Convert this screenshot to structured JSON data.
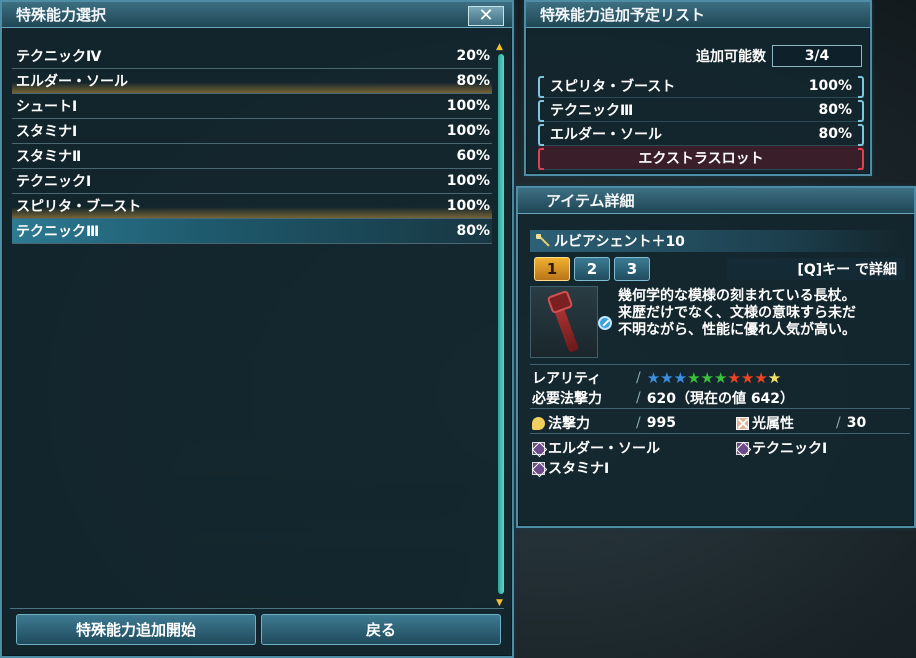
{
  "select_panel": {
    "title": "特殊能力選択",
    "close_glyph": "✕",
    "abilities": [
      {
        "name": "テクニックⅣ",
        "rate": "20%",
        "state": "normal"
      },
      {
        "name": "エルダー・ソール",
        "rate": "80%",
        "state": "selected"
      },
      {
        "name": "シュートⅠ",
        "rate": "100%",
        "state": "normal"
      },
      {
        "name": "スタミナⅠ",
        "rate": "100%",
        "state": "normal"
      },
      {
        "name": "スタミナⅡ",
        "rate": "60%",
        "state": "normal"
      },
      {
        "name": "テクニックⅠ",
        "rate": "100%",
        "state": "normal"
      },
      {
        "name": "スピリタ・ブースト",
        "rate": "100%",
        "state": "selected"
      },
      {
        "name": "テクニックⅢ",
        "rate": "80%",
        "state": "cursor"
      }
    ],
    "start_button": "特殊能力追加開始",
    "back_button": "戻る"
  },
  "queue_panel": {
    "title": "特殊能力追加予定リスト",
    "available_label": "追加可能数",
    "available_value": "3/4",
    "items": [
      {
        "name": "スピリタ・ブースト",
        "rate": "100%"
      },
      {
        "name": "テクニックⅢ",
        "rate": "80%"
      },
      {
        "name": "エルダー・ソール",
        "rate": "80%"
      }
    ],
    "extra_slot": "エクストラスロット"
  },
  "detail_panel": {
    "title": "アイテム詳細",
    "item_name": "ルビアシェント＋10",
    "tabs": [
      "1",
      "2",
      "3"
    ],
    "active_tab": "1",
    "detail_hint": "[Q]キー で詳細",
    "description": [
      "幾何学的な模様の刻まれている長杖。",
      "来歴だけでなく、文様の意味すら未だ",
      "不明ながら、性能に優れ人気が高い。"
    ],
    "rarity_label": "レアリティ",
    "rarity_stars": 10,
    "star_colors": [
      "#3a8fe0",
      "#3a8fe0",
      "#3a8fe0",
      "#38c038",
      "#38c038",
      "#38c038",
      "#ee4422",
      "#ee4422",
      "#ee4422",
      "#f4e060"
    ],
    "required_label": "必要法撃力",
    "required_value": "620（現在の値 642）",
    "tech_label": "法撃力",
    "tech_value": "995",
    "element_label": "光属性",
    "element_value": "30",
    "abilities": [
      "エルダー・ソール",
      "テクニックⅠ",
      "スタミナⅠ"
    ]
  }
}
